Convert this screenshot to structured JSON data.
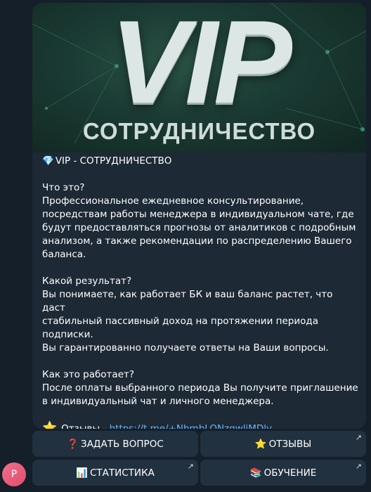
{
  "banner": {
    "title": "VIP",
    "subtitle": "СОТРУДНИЧЕСТВО"
  },
  "message": {
    "heading_icon": "gem-icon",
    "heading": "VIP - СОТРУДНИЧЕСТВО",
    "sections": [
      {
        "title": "Что это?",
        "lines": [
          "Профессиональное ежедневное консультирование,",
          "посредствам работы менеджера в индивидуальном чате, где",
          "будут предоставляться прогнозы от аналитиков с подробным",
          "анализом, а также рекомендации по распределению Вашего",
          "баланса."
        ]
      },
      {
        "title": "Какой результат?",
        "lines": [
          "Вы понимаете, как работает БК и ваш баланс растет, что даст",
          "стабильный пассивный доход на протяжении периода",
          "подписки.",
          "Вы гарантированно получаете ответы на Ваши вопросы."
        ]
      },
      {
        "title": "Как это работает?",
        "lines": [
          "После оплаты выбранного периода Вы получите приглашение",
          "в индивидуальный чат и личного менеджера."
        ]
      }
    ],
    "reviews_icon": "star-icon",
    "reviews_label": "Отзывы",
    "reviews_sep": " - ",
    "reviews_link": "https://t.me/+NbmbLONzgwljMDly"
  },
  "keyboard": {
    "buttons": [
      {
        "icon": "❓",
        "icon_name": "question-icon",
        "label": "ЗАДАТЬ ВОПРОС"
      },
      {
        "icon": "⭐",
        "icon_name": "star-icon",
        "label": "ОТЗЫВЫ"
      },
      {
        "icon": "📊",
        "icon_name": "chart-icon",
        "label": "СТАТИСТИКА"
      },
      {
        "icon": "📚",
        "icon_name": "books-icon",
        "label": "ОБУЧЕНИЕ"
      }
    ],
    "arrow": "↗"
  },
  "avatar": {
    "initial": "P"
  }
}
